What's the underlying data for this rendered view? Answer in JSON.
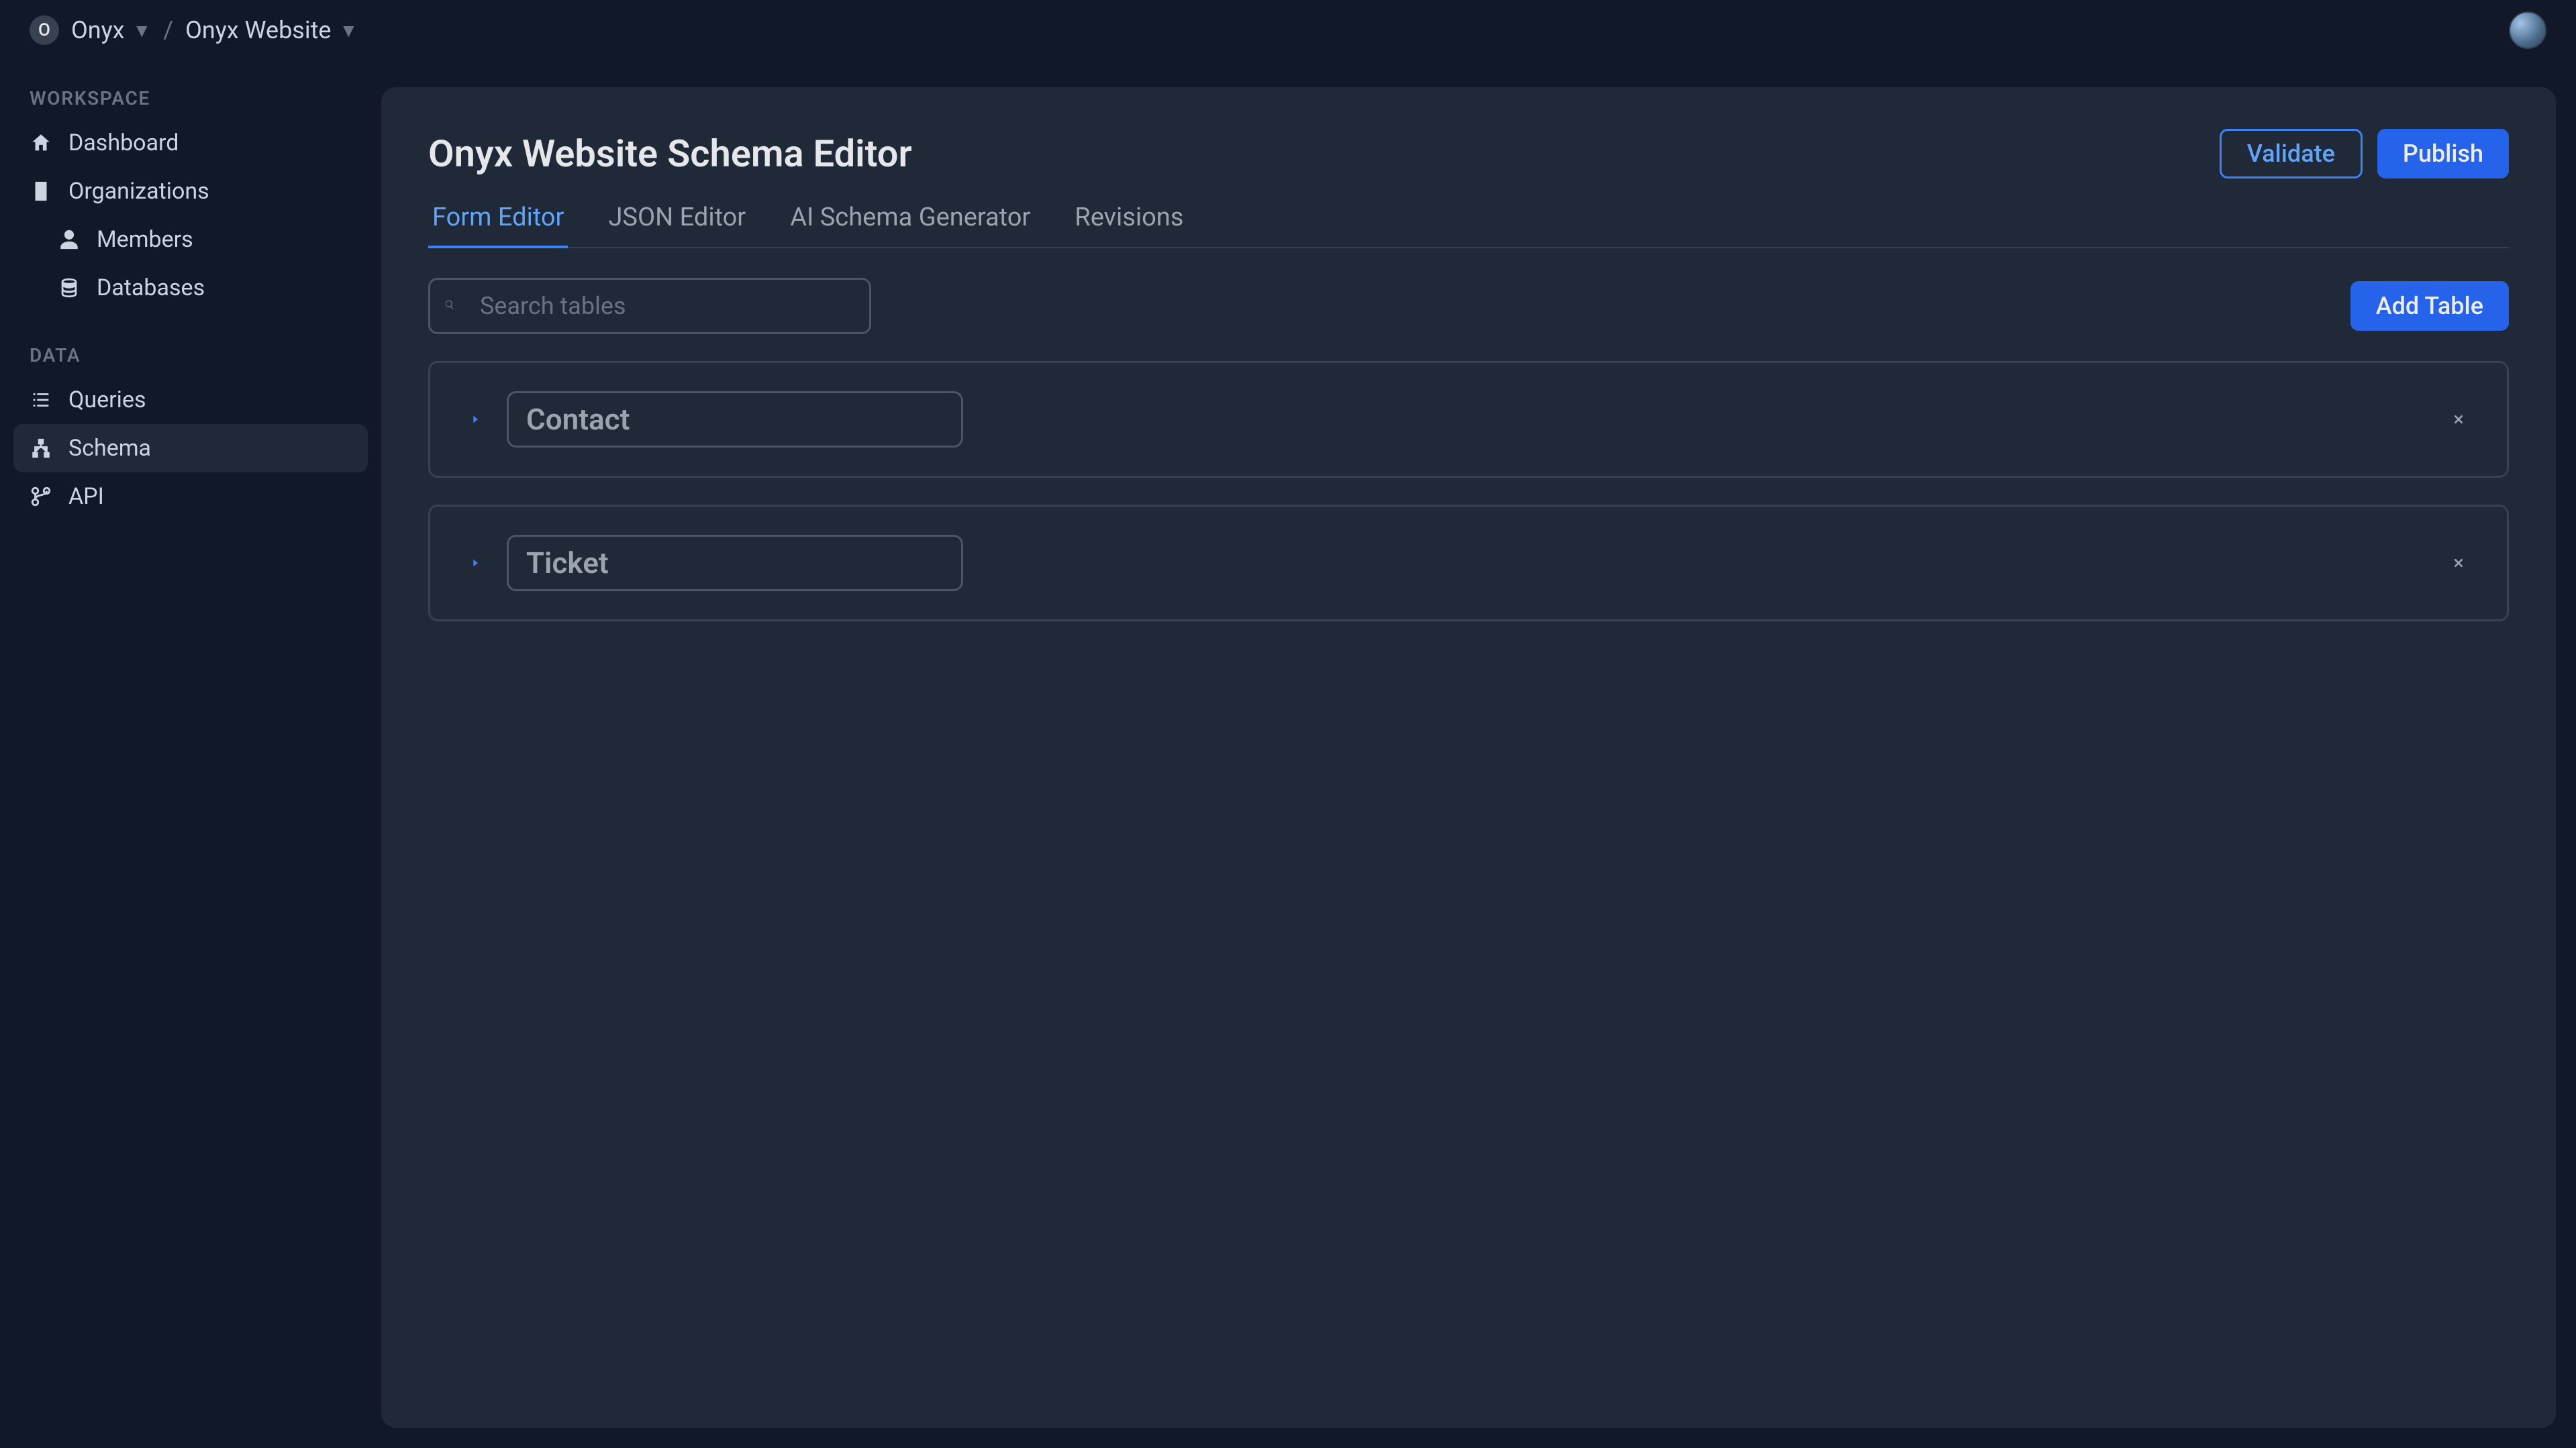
{
  "breadcrumb": {
    "org_initial": "O",
    "org_name": "Onyx",
    "project_name": "Onyx Website"
  },
  "sidebar": {
    "sections": [
      {
        "label": "WORKSPACE",
        "items": [
          {
            "label": "Dashboard",
            "icon": "home-icon",
            "indent": false,
            "active": false
          },
          {
            "label": "Organizations",
            "icon": "building-icon",
            "indent": false,
            "active": false
          },
          {
            "label": "Members",
            "icon": "user-icon",
            "indent": true,
            "active": false
          },
          {
            "label": "Databases",
            "icon": "database-icon",
            "indent": true,
            "active": false
          }
        ]
      },
      {
        "label": "DATA",
        "items": [
          {
            "label": "Queries",
            "icon": "list-icon",
            "indent": false,
            "active": false
          },
          {
            "label": "Schema",
            "icon": "sitemap-icon",
            "indent": false,
            "active": true
          },
          {
            "label": "API",
            "icon": "branch-icon",
            "indent": false,
            "active": false
          }
        ]
      }
    ]
  },
  "page": {
    "title": "Onyx Website Schema Editor",
    "validate_label": "Validate",
    "publish_label": "Publish"
  },
  "tabs": [
    {
      "label": "Form Editor",
      "active": true
    },
    {
      "label": "JSON Editor",
      "active": false
    },
    {
      "label": "AI Schema Generator",
      "active": false
    },
    {
      "label": "Revisions",
      "active": false
    }
  ],
  "toolbar": {
    "search_placeholder": "Search tables",
    "add_table_label": "Add Table"
  },
  "tables": [
    {
      "name": "Contact"
    },
    {
      "name": "Ticket"
    }
  ]
}
